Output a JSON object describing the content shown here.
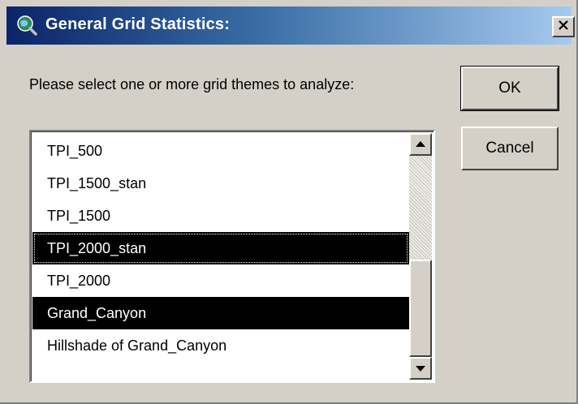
{
  "window": {
    "title": "General Grid Statistics:"
  },
  "dialog": {
    "prompt": "Please select one or more grid themes to analyze:",
    "ok_label": "OK",
    "cancel_label": "Cancel"
  },
  "list": {
    "items": [
      {
        "label": "TPI_500",
        "selected": false
      },
      {
        "label": "TPI_1500_stan",
        "selected": false
      },
      {
        "label": "TPI_1500",
        "selected": false
      },
      {
        "label": "TPI_2000_stan",
        "selected": true,
        "focused": true
      },
      {
        "label": "TPI_2000",
        "selected": false
      },
      {
        "label": "Grand_Canyon",
        "selected": true
      },
      {
        "label": "Hillshade of Grand_Canyon",
        "selected": false
      }
    ],
    "scroll_position": 0.85
  },
  "icons": {
    "title_icon": "globe-magnifier-icon",
    "close_icon": "close-icon",
    "scroll_up_icon": "scroll-up-arrow-icon",
    "scroll_down_icon": "scroll-down-arrow-icon"
  },
  "colors": {
    "title_gradient_start": "#0a246a",
    "title_gradient_end": "#a6caf0",
    "dialog_face": "#d4d0c8",
    "selection": "#000000"
  }
}
